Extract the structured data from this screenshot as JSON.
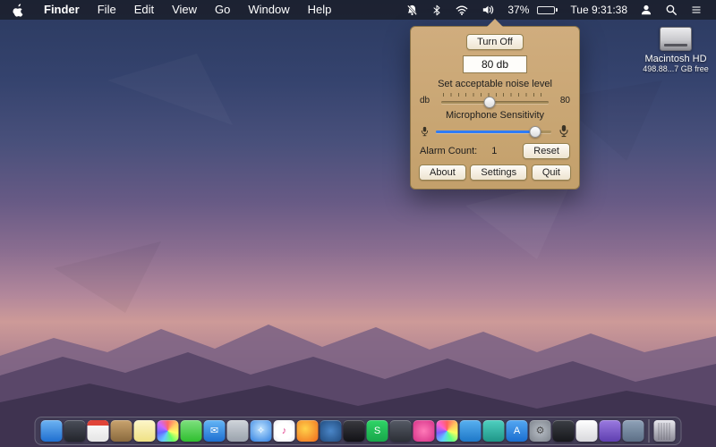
{
  "menubar": {
    "items": [
      "Finder",
      "File",
      "Edit",
      "View",
      "Go",
      "Window",
      "Help"
    ],
    "status": {
      "icons": [
        "mute-bell-icon",
        "bluetooth-icon",
        "wifi-icon",
        "volume-icon",
        "battery-icon",
        "user-icon",
        "search-icon",
        "notification-center-icon"
      ],
      "battery_pct": "37%",
      "clock": "Tue 9:31:38"
    }
  },
  "popover": {
    "turn_off_label": "Turn Off",
    "db_value": "80 db",
    "noise_label": "Set acceptable noise level",
    "noise_min_label": "db",
    "noise_max_label": "80",
    "noise_slider_pct": 45,
    "mic_label": "Microphone Sensitivity",
    "mic_slider_pct": 86,
    "alarm_count_label": "Alarm Count:",
    "alarm_count_value": "1",
    "reset_label": "Reset",
    "about_label": "About",
    "settings_label": "Settings",
    "quit_label": "Quit",
    "accent_blue": "#2f7cf6",
    "panel_tan": "#c9a771"
  },
  "desktop_icon": {
    "title": "Macintosh HD",
    "subtitle": "498.88...7 GB free"
  },
  "dock": {
    "icons": [
      {
        "name": "finder",
        "bg": "linear-gradient(180deg,#6db3f2,#1f6fd0)"
      },
      {
        "name": "app-dark-1",
        "bg": "linear-gradient(180deg,#4a4e59,#23252c)"
      },
      {
        "name": "calendar",
        "bg": "linear-gradient(180deg,#ffffff,#e4e4e4)",
        "cls": "cal"
      },
      {
        "name": "contacts",
        "bg": "linear-gradient(180deg,#c9a36e,#8a6a3e)"
      },
      {
        "name": "notes",
        "bg": "linear-gradient(180deg,#fdf6c9,#efe184)"
      },
      {
        "name": "photos",
        "bg": "conic-gradient(#f66,#fc6,#ff6,#6f6,#6cf,#66f,#c6f,#f66)"
      },
      {
        "name": "messages",
        "bg": "linear-gradient(180deg,#7ee07e,#2fbf2f)"
      },
      {
        "name": "mail",
        "bg": "linear-gradient(180deg,#64b5f6,#1e6fd0)",
        "glyph": "✉"
      },
      {
        "name": "app-gray-1",
        "bg": "linear-gradient(180deg,#cfd4da,#9aa2ac)"
      },
      {
        "name": "safari",
        "bg": "radial-gradient(circle at 50% 40%,#bfe3ff,#2f7fe0)",
        "glyph": "✧"
      },
      {
        "name": "itunes",
        "bg": "radial-gradient(circle,#ffffff 55%,#e6e6ee)",
        "glyph": "♪",
        "color": "#e0418c"
      },
      {
        "name": "firefox",
        "bg": "radial-gradient(circle at 40% 40%,#ffd24a,#f06a1d)"
      },
      {
        "name": "app-blue-globe",
        "bg": "radial-gradient(circle,#4a86c8,#204a7c)"
      },
      {
        "name": "app-black",
        "bg": "linear-gradient(180deg,#3a3a40,#121216)"
      },
      {
        "name": "spotify",
        "bg": "linear-gradient(180deg,#2fd567,#18a64a)",
        "glyph": "S"
      },
      {
        "name": "app-dark-2",
        "bg": "linear-gradient(180deg,#565b66,#2c2f36)"
      },
      {
        "name": "photo-booth",
        "bg": "radial-gradient(circle,#ff7ab8,#d42f86)"
      },
      {
        "name": "pinwheel",
        "bg": "conic-gradient(#ff5f5f,#ffc75f,#f9ff5f,#5fff87,#5fd0ff,#7a5fff,#ff5fd0,#ff5f5f)"
      },
      {
        "name": "app-blue",
        "bg": "linear-gradient(180deg,#58b0f0,#1e78c8)"
      },
      {
        "name": "app-teal",
        "bg": "linear-gradient(180deg,#4fd0c0,#1f9688)"
      },
      {
        "name": "app-store",
        "bg": "linear-gradient(180deg,#54a7f2,#1a6ed0)",
        "glyph": "A"
      },
      {
        "name": "system-preferences",
        "bg": "radial-gradient(circle,#b8bec6,#7d838c)",
        "glyph": "⚙",
        "color": "#4a4a4a"
      },
      {
        "name": "terminal",
        "bg": "linear-gradient(180deg,#3c3f45,#17181c)"
      },
      {
        "name": "app-white",
        "bg": "linear-gradient(180deg,#ffffff,#d8d8dc)"
      },
      {
        "name": "app-purple",
        "bg": "linear-gradient(180deg,#9a7ae0,#5f3fb0)"
      },
      {
        "name": "downloads",
        "bg": "linear-gradient(180deg,#8fa2b8,#5c6f86)"
      }
    ]
  }
}
